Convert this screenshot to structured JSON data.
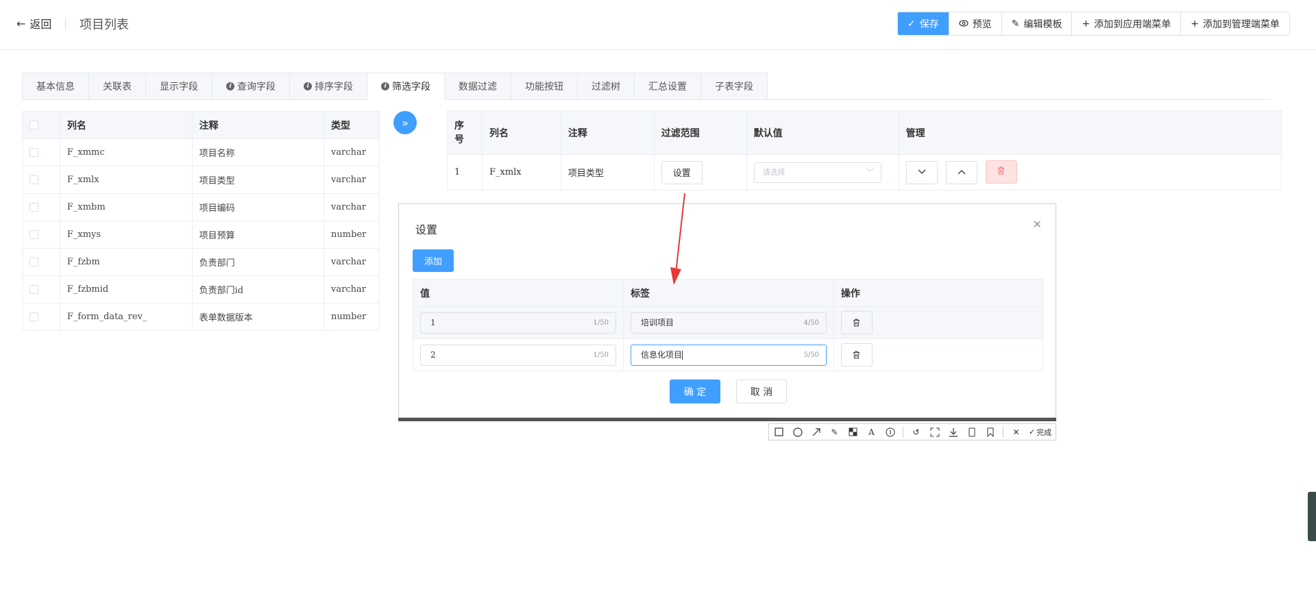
{
  "header": {
    "back_label": "返回",
    "title": "项目列表",
    "buttons": {
      "save": "保存",
      "preview": "预览",
      "edit_template": "编辑模板",
      "add_app_menu": "添加到应用端菜单",
      "add_admin_menu": "添加到管理端菜单"
    }
  },
  "tabs": [
    {
      "label": "基本信息",
      "info": false
    },
    {
      "label": "关联表",
      "info": false
    },
    {
      "label": "显示字段",
      "info": false
    },
    {
      "label": "查询字段",
      "info": true
    },
    {
      "label": "排序字段",
      "info": true
    },
    {
      "label": "筛选字段",
      "info": true,
      "active": true
    },
    {
      "label": "数据过滤",
      "info": false
    },
    {
      "label": "功能按钮",
      "info": false
    },
    {
      "label": "过滤树",
      "info": false
    },
    {
      "label": "汇总设置",
      "info": false
    },
    {
      "label": "子表字段",
      "info": false
    }
  ],
  "left_table": {
    "columns": [
      "列名",
      "注释",
      "类型"
    ],
    "rows": [
      [
        "F_xmmc",
        "项目名称",
        "varchar"
      ],
      [
        "F_xmlx",
        "项目类型",
        "varchar"
      ],
      [
        "F_xmbm",
        "项目编码",
        "varchar"
      ],
      [
        "F_xmys",
        "项目预算",
        "number"
      ],
      [
        "F_fzbm",
        "负责部门",
        "varchar"
      ],
      [
        "F_fzbmid",
        "负责部门id",
        "varchar"
      ],
      [
        "F_form_data_rev_",
        "表单数据版本",
        "number"
      ]
    ]
  },
  "right_table": {
    "columns": [
      "序号",
      "列名",
      "注释",
      "过滤范围",
      "默认值",
      "管理"
    ],
    "rows": [
      {
        "index": "1",
        "column": "F_xmlx",
        "comment": "项目类型",
        "set_label": "设置",
        "default_placeholder": "请选择"
      }
    ]
  },
  "dialog": {
    "title": "设置",
    "add_label": "添加",
    "columns": [
      "值",
      "标签",
      "操作"
    ],
    "rows": [
      {
        "value": "1",
        "value_count": "1/50",
        "label": "培训项目",
        "label_count": "4/50"
      },
      {
        "value": "2",
        "value_count": "1/50",
        "label": "信息化项目",
        "label_count": "5/50"
      }
    ],
    "confirm_label": "确 定",
    "cancel_label": "取 消"
  },
  "screenshot_toolbar": {
    "done_label": "完成"
  },
  "colors": {
    "primary": "#409eff",
    "danger": "#f56c6c",
    "annotation_arrow": "#e53935"
  }
}
